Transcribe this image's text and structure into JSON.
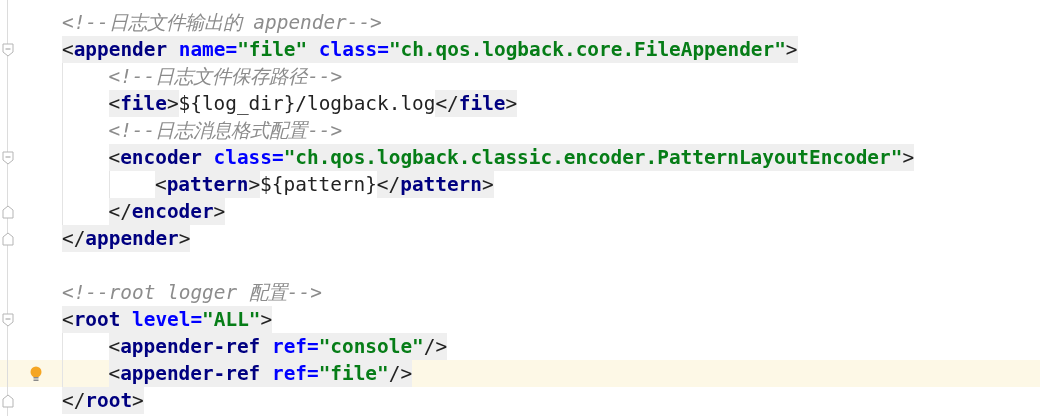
{
  "editor": {
    "lines": [
      {
        "kind": "comment",
        "text": "<!--日志文件输出的 appender-->"
      },
      {
        "kind": "code",
        "fold_start": true,
        "current": false,
        "bulb": false,
        "tags": [
          {
            "kind": "tag",
            "parts": [
              {
                "kind": "punct",
                "text": "<"
              },
              {
                "kind": "name",
                "text": "appender"
              },
              {
                "kind": "attr",
                "text": "name="
              },
              {
                "kind": "value",
                "text": "\"file\""
              },
              {
                "kind": "attr",
                "text": "class="
              },
              {
                "kind": "value",
                "text": "\"ch.qos.logback.core.FileAppender\""
              },
              {
                "kind": "punct",
                "text": ">"
              }
            ]
          }
        ],
        "children": [
          {
            "kind": "comment",
            "text": "<!--日志文件保存路径-->"
          },
          {
            "kind": "code",
            "current": false,
            "bulb": false,
            "tags": [
              {
                "kind": "tag",
                "parts": [
                  {
                    "kind": "punct",
                    "text": "<"
                  },
                  {
                    "kind": "name",
                    "text": "file"
                  },
                  {
                    "kind": "punct",
                    "text": ">"
                  }
                ]
              },
              {
                "kind": "text",
                "text": "${log_dir}/logback.log"
              },
              {
                "kind": "tag",
                "parts": [
                  {
                    "kind": "punct",
                    "text": "</"
                  },
                  {
                    "kind": "name",
                    "text": "file"
                  },
                  {
                    "kind": "punct",
                    "text": ">"
                  }
                ]
              }
            ]
          },
          {
            "kind": "comment",
            "text": "<!--日志消息格式配置-->"
          },
          {
            "kind": "code",
            "fold_start": true,
            "current": false,
            "bulb": false,
            "tags": [
              {
                "kind": "tag",
                "parts": [
                  {
                    "kind": "punct",
                    "text": "<"
                  },
                  {
                    "kind": "name",
                    "text": "encoder"
                  },
                  {
                    "kind": "attr",
                    "text": "class="
                  },
                  {
                    "kind": "value",
                    "text": "\"ch.qos.logback.classic.encoder.PatternLayoutEncoder\""
                  },
                  {
                    "kind": "punct",
                    "text": ">"
                  }
                ]
              }
            ],
            "children": [
              {
                "kind": "code",
                "current": false,
                "bulb": false,
                "tags": [
                  {
                    "kind": "tag",
                    "parts": [
                      {
                        "kind": "punct",
                        "text": "<"
                      },
                      {
                        "kind": "name",
                        "text": "pattern"
                      },
                      {
                        "kind": "punct",
                        "text": ">"
                      }
                    ]
                  },
                  {
                    "kind": "text",
                    "text": "${pattern}"
                  },
                  {
                    "kind": "tag",
                    "parts": [
                      {
                        "kind": "punct",
                        "text": "</"
                      },
                      {
                        "kind": "name",
                        "text": "pattern"
                      },
                      {
                        "kind": "punct",
                        "text": ">"
                      }
                    ]
                  }
                ]
              }
            ]
          },
          {
            "kind": "code",
            "fold_end": true,
            "current": false,
            "bulb": false,
            "tags": [
              {
                "kind": "tag",
                "parts": [
                  {
                    "kind": "punct",
                    "text": "</"
                  },
                  {
                    "kind": "name",
                    "text": "encoder"
                  },
                  {
                    "kind": "punct",
                    "text": ">"
                  }
                ]
              }
            ]
          }
        ]
      },
      {
        "kind": "code",
        "fold_end": true,
        "current": false,
        "bulb": false,
        "tags": [
          {
            "kind": "tag",
            "parts": [
              {
                "kind": "punct",
                "text": "</"
              },
              {
                "kind": "name",
                "text": "appender"
              },
              {
                "kind": "punct",
                "text": ">"
              }
            ]
          }
        ]
      },
      {
        "kind": "blank"
      },
      {
        "kind": "comment",
        "text": "<!--root logger 配置-->"
      },
      {
        "kind": "code",
        "fold_start": true,
        "current": false,
        "bulb": false,
        "tags": [
          {
            "kind": "tag",
            "parts": [
              {
                "kind": "punct",
                "text": "<"
              },
              {
                "kind": "name",
                "text": "root"
              },
              {
                "kind": "attr",
                "text": "level="
              },
              {
                "kind": "value",
                "text": "\"ALL\""
              },
              {
                "kind": "punct",
                "text": ">"
              }
            ]
          }
        ],
        "children": [
          {
            "kind": "code",
            "current": false,
            "bulb": false,
            "tags": [
              {
                "kind": "tag",
                "parts": [
                  {
                    "kind": "punct",
                    "text": "<"
                  },
                  {
                    "kind": "name",
                    "text": "appender-ref"
                  },
                  {
                    "kind": "attr",
                    "text": "ref="
                  },
                  {
                    "kind": "value",
                    "text": "\"console\""
                  },
                  {
                    "kind": "punct",
                    "text": "/>"
                  }
                ]
              }
            ]
          },
          {
            "kind": "code",
            "current": true,
            "bulb": true,
            "tags": [
              {
                "kind": "tag",
                "parts": [
                  {
                    "kind": "punct",
                    "text": "<"
                  },
                  {
                    "kind": "name",
                    "text": "appender-ref"
                  },
                  {
                    "kind": "attr",
                    "text": "ref="
                  },
                  {
                    "kind": "value",
                    "text": "\"file\""
                  },
                  {
                    "kind": "punct",
                    "text": "/>"
                  }
                ]
              }
            ]
          }
        ]
      },
      {
        "kind": "code",
        "fold_end": true,
        "current": false,
        "bulb": false,
        "tags": [
          {
            "kind": "tag",
            "parts": [
              {
                "kind": "punct",
                "text": "</"
              },
              {
                "kind": "name",
                "text": "root"
              },
              {
                "kind": "punct",
                "text": ">"
              }
            ]
          }
        ]
      }
    ]
  }
}
